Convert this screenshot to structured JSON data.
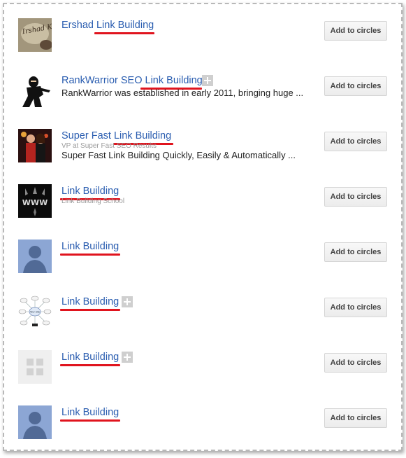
{
  "button_label": "Add to circles",
  "people": [
    {
      "name_prefix": "Ershad ",
      "name_keyword": "Link Building",
      "subtitle": "",
      "description": "",
      "avatar": "logo-sketch",
      "avatar_text": "Irshad Khan",
      "has_plus_badge": false
    },
    {
      "name_prefix": "RankWarrior SEO ",
      "name_keyword": "Link Building",
      "subtitle": "",
      "description": "RankWarrior was established in early 2011, bringing huge ...",
      "avatar": "ninja-photo",
      "has_plus_badge": true
    },
    {
      "name_prefix": "Super Fast ",
      "name_keyword": "Link Building",
      "subtitle": "VP at Super Fast SEO Results",
      "description": "Super Fast Link Building Quickly, Easily & Automatically ...",
      "avatar": "couple-photo",
      "has_plus_badge": false
    },
    {
      "name_prefix": "",
      "name_keyword": "Link Building",
      "subtitle": "Link Building School",
      "description": "",
      "avatar": "www-logo",
      "avatar_text": "WWW",
      "has_plus_badge": false
    },
    {
      "name_prefix": "",
      "name_keyword": "Link Building",
      "subtitle": "",
      "description": "",
      "avatar": "default-silhouette",
      "has_plus_badge": false
    },
    {
      "name_prefix": "",
      "name_keyword": "Link Building",
      "subtitle": "",
      "description": "",
      "avatar": "mindmap-diagram",
      "avatar_text": "Your Site",
      "has_plus_badge": true
    },
    {
      "name_prefix": "",
      "name_keyword": "Link Building",
      "subtitle": "",
      "description": "",
      "avatar": "page-placeholder",
      "has_plus_badge": true
    },
    {
      "name_prefix": "",
      "name_keyword": "Link Building",
      "subtitle": "",
      "description": "",
      "avatar": "default-silhouette",
      "has_plus_badge": false
    }
  ],
  "colors": {
    "link": "#2a5db0",
    "underline": "#e0141e",
    "text": "#222222",
    "subtitle": "#9a9a9a",
    "button_text": "#444444"
  }
}
